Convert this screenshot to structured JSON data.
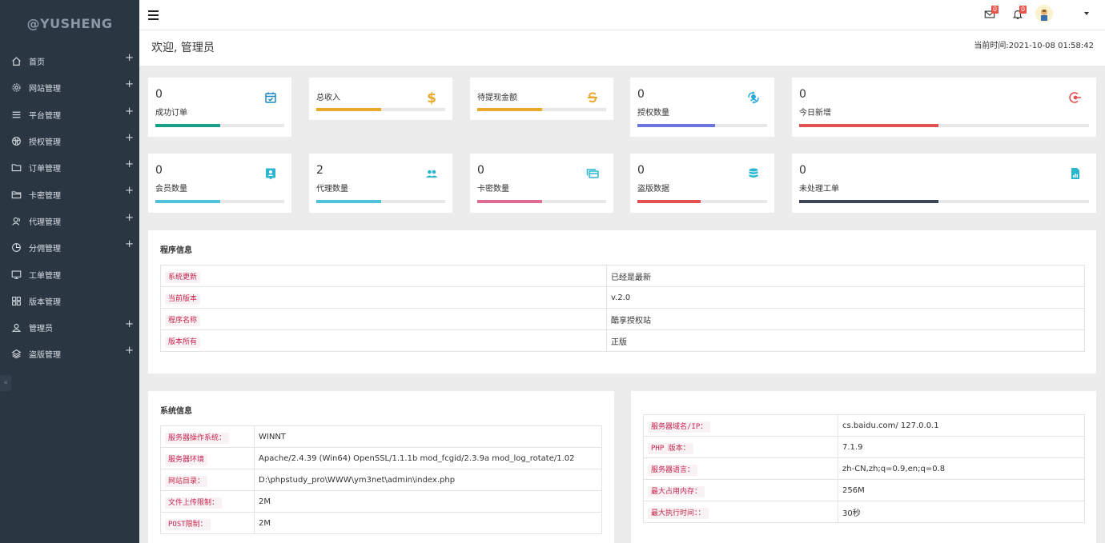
{
  "sidebar": {
    "brand": "@YUSHENG",
    "items": [
      {
        "label": "首页",
        "icon": "home-icon",
        "expand": "+"
      },
      {
        "label": "网站管理",
        "icon": "gear-icon",
        "expand": "+"
      },
      {
        "label": "平台管理",
        "icon": "list-icon",
        "expand": "+"
      },
      {
        "label": "授权管理",
        "icon": "ball-icon",
        "expand": "+"
      },
      {
        "label": "订单管理",
        "icon": "folder-icon",
        "expand": "+"
      },
      {
        "label": "卡密管理",
        "icon": "folder-open-icon",
        "expand": "+"
      },
      {
        "label": "代理管理",
        "icon": "user-group-icon",
        "expand": "+"
      },
      {
        "label": "分佣管理",
        "icon": "pie-icon",
        "expand": "+"
      },
      {
        "label": "工单管理",
        "icon": "monitor-icon",
        "expand": ""
      },
      {
        "label": "版本管理",
        "icon": "grid-icon",
        "expand": ""
      },
      {
        "label": "管理员",
        "icon": "user-icon",
        "expand": "+"
      },
      {
        "label": "盗版管理",
        "icon": "layers-icon",
        "expand": "+"
      }
    ],
    "collapse": "«"
  },
  "topbar": {
    "mail_badge": "0",
    "bell_badge": "0"
  },
  "welcome": {
    "title": "欢迎, 管理员",
    "time": "当前时间:2021-10-08 01:58:42"
  },
  "stats": {
    "orders": {
      "value": "0",
      "label": "成功订单",
      "percent": 50,
      "color": "#16a085"
    },
    "income": {
      "value": "",
      "label": "总收入",
      "percent": 50,
      "color": "#e9a82a"
    },
    "withdraw": {
      "value": "",
      "label": "待提现金额",
      "percent": 50,
      "color": "#e9a82a"
    },
    "auth": {
      "value": "0",
      "label": "授权数量",
      "percent": 60,
      "color": "#6c74e0"
    },
    "today": {
      "value": "0",
      "label": "今日新增",
      "percent": 48,
      "color": "#e25252"
    },
    "members": {
      "value": "0",
      "label": "会员数量",
      "percent": 50,
      "color": "#4fc4d9"
    },
    "agents": {
      "value": "2",
      "label": "代理数量",
      "percent": 50,
      "color": "#4fc4d9"
    },
    "cards": {
      "value": "0",
      "label": "卡密数量",
      "percent": 50,
      "color": "#e16c93"
    },
    "piracy": {
      "value": "0",
      "label": "盗版数据",
      "percent": 49,
      "color": "#e25252"
    },
    "tickets": {
      "value": "0",
      "label": "未处理工单",
      "percent": 48,
      "color": "#3f4653"
    }
  },
  "program": {
    "title": "程序信息",
    "rows": [
      {
        "k": "系统更新",
        "v": "已经是最新"
      },
      {
        "k": "当前版本",
        "v": "v.2.0"
      },
      {
        "k": "程序名称",
        "v": "酷享授权站"
      },
      {
        "k": "版本所有",
        "v": "正版"
      }
    ]
  },
  "system": {
    "title": "系统信息",
    "rows": [
      {
        "k": "服务器操作系统：",
        "v": "WINNT"
      },
      {
        "k": "服务器环境",
        "v": "Apache/2.4.39 (Win64) OpenSSL/1.1.1b mod_fcgid/2.3.9a mod_log_rotate/1.02"
      },
      {
        "k": "网站目录：",
        "v": "D:\\phpstudy_pro\\WWW\\ym3net\\admin\\index.php"
      },
      {
        "k": "文件上传限制：",
        "v": "2M"
      },
      {
        "k": "POST限制：",
        "v": "2M"
      }
    ]
  },
  "server": {
    "rows": [
      {
        "k": "服务器域名/IP：",
        "v": "cs.baidu.com/ 127.0.0.1"
      },
      {
        "k": "PHP 版本：",
        "v": "7.1.9"
      },
      {
        "k": "服务器语言：",
        "v": "zh-CN,zh;q=0.9,en;q=0.8"
      },
      {
        "k": "最大占用内存：",
        "v": "256M"
      },
      {
        "k": "最大执行时间：：",
        "v": "30秒"
      }
    ]
  }
}
